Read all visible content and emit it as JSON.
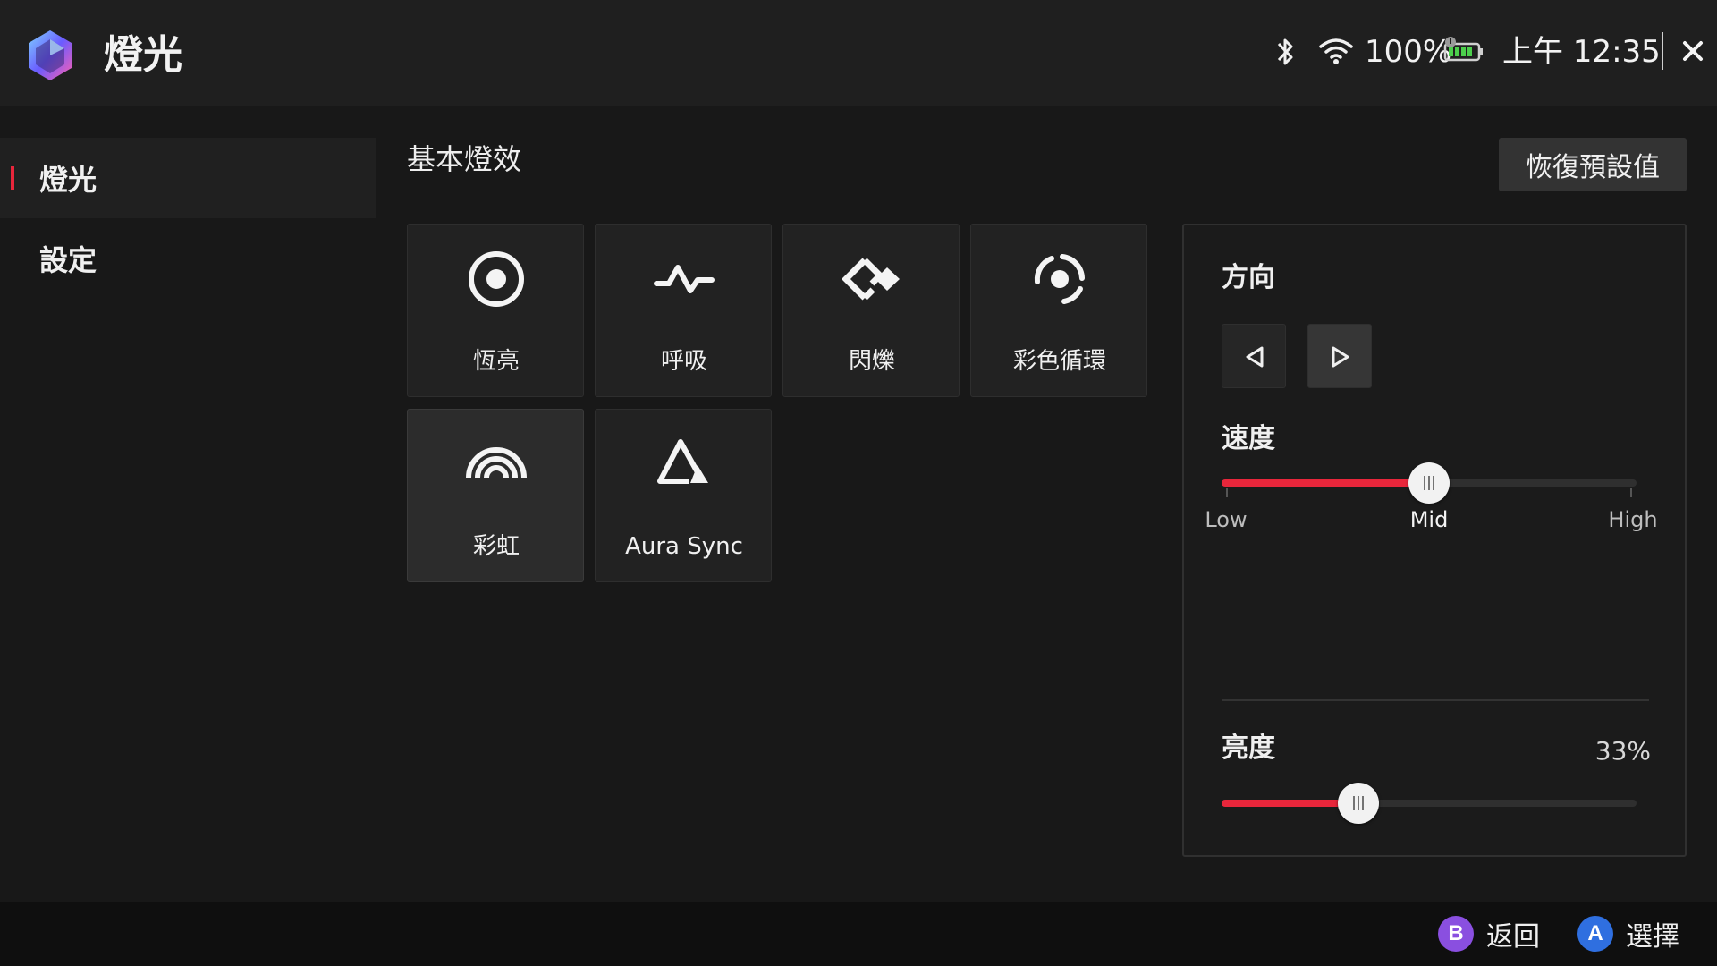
{
  "header": {
    "app_title": "燈光",
    "battery_percent": "100%",
    "time": "上午 12:35",
    "icons": [
      "app-logo",
      "bluetooth-icon",
      "wifi-icon",
      "battery-icon",
      "close-icon"
    ]
  },
  "sidebar": {
    "items": [
      {
        "label": "燈光",
        "active": true
      },
      {
        "label": "設定",
        "active": false
      }
    ]
  },
  "main": {
    "section_title": "基本燈效",
    "reset_label": "恢復預設值",
    "effects": [
      {
        "label": "恆亮",
        "icon": "static-icon",
        "selected": false
      },
      {
        "label": "呼吸",
        "icon": "breathing-icon",
        "selected": false
      },
      {
        "label": "閃爍",
        "icon": "strobing-icon",
        "selected": false
      },
      {
        "label": "彩色循環",
        "icon": "color-cycle-icon",
        "selected": false
      },
      {
        "label": "彩虹",
        "icon": "rainbow-icon",
        "selected": true
      },
      {
        "label": "Aura Sync",
        "icon": "aura-sync-icon",
        "selected": false
      }
    ]
  },
  "panel": {
    "direction_label": "方向",
    "direction_selected": "right",
    "speed_label": "速度",
    "speed_ticks": [
      "Low",
      "Mid",
      "High"
    ],
    "speed_value": "Mid",
    "brightness_label": "亮度",
    "brightness_value": "33%",
    "brightness_fraction": 0.33
  },
  "footer": {
    "hints": [
      {
        "button": "B",
        "label": "返回",
        "color": "#8a4fe0"
      },
      {
        "button": "A",
        "label": "選擇",
        "color": "#2f6fe0"
      }
    ]
  },
  "colors": {
    "accent": "#e8263b",
    "background": "#181818"
  }
}
